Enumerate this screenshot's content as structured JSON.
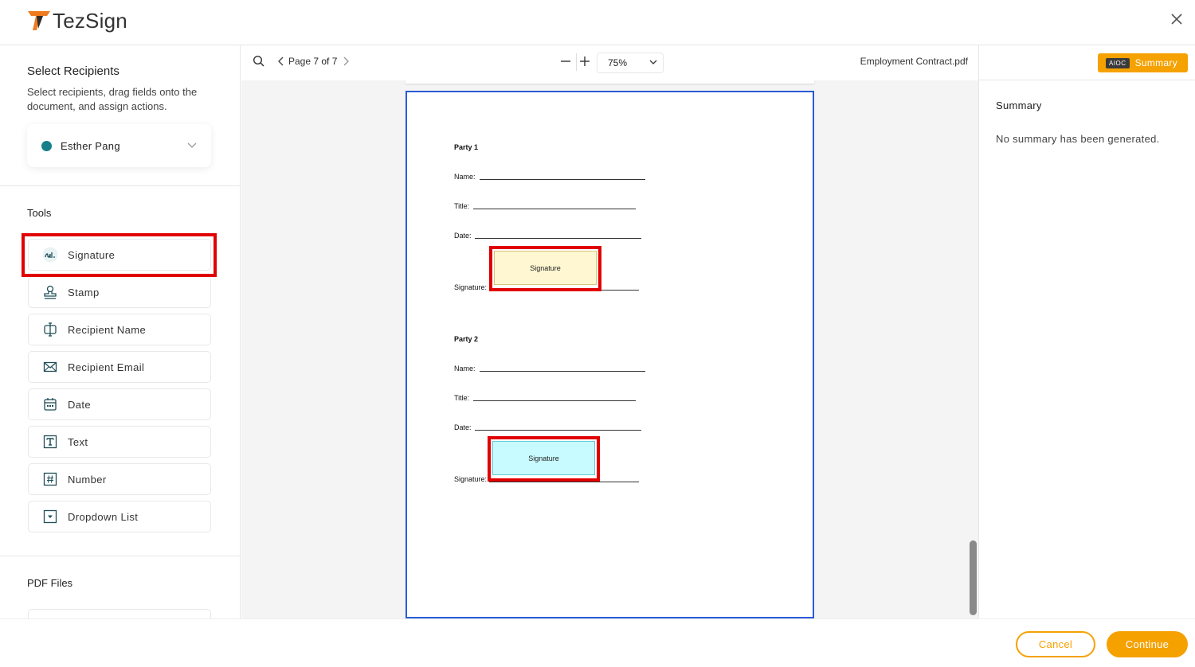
{
  "app": {
    "name": "TezSign",
    "brand_color": "#f5a100"
  },
  "recipients": {
    "title": "Select Recipients",
    "description": "Select recipients, drag fields onto the document, and assign actions.",
    "selected": {
      "name": "Esther Pang",
      "color": "#167f8a"
    }
  },
  "tools": {
    "title": "Tools",
    "items": [
      {
        "label": "Signature",
        "icon": "signature-icon"
      },
      {
        "label": "Stamp",
        "icon": "stamp-icon"
      },
      {
        "label": "Recipient Name",
        "icon": "recipient-name-icon"
      },
      {
        "label": "Recipient Email",
        "icon": "envelope-icon"
      },
      {
        "label": "Date",
        "icon": "calendar-icon"
      },
      {
        "label": "Text",
        "icon": "text-icon"
      },
      {
        "label": "Number",
        "icon": "hash-icon"
      },
      {
        "label": "Dropdown List",
        "icon": "dropdown-icon"
      }
    ]
  },
  "pdf_files": {
    "title": "PDF Files"
  },
  "toolbar": {
    "page_label": "Page",
    "page_value": "7 of 7",
    "zoom": "75%",
    "file_name": "Employment Contract.pdf"
  },
  "document": {
    "party1": {
      "heading": "Party 1",
      "name_label": "Name:",
      "title_label": "Title:",
      "date_label": "Date:",
      "signature_label": "Signature:",
      "field_label": "Signature"
    },
    "party2": {
      "heading": "Party 2",
      "name_label": "Name:",
      "title_label": "Title:",
      "date_label": "Date:",
      "signature_label": "Signature:",
      "field_label": "Signature"
    }
  },
  "summary": {
    "badge": "AIOC",
    "button_label": "Summary",
    "title": "Summary",
    "text": "No summary has been generated."
  },
  "footer": {
    "cancel": "Cancel",
    "continue": "Continue"
  }
}
